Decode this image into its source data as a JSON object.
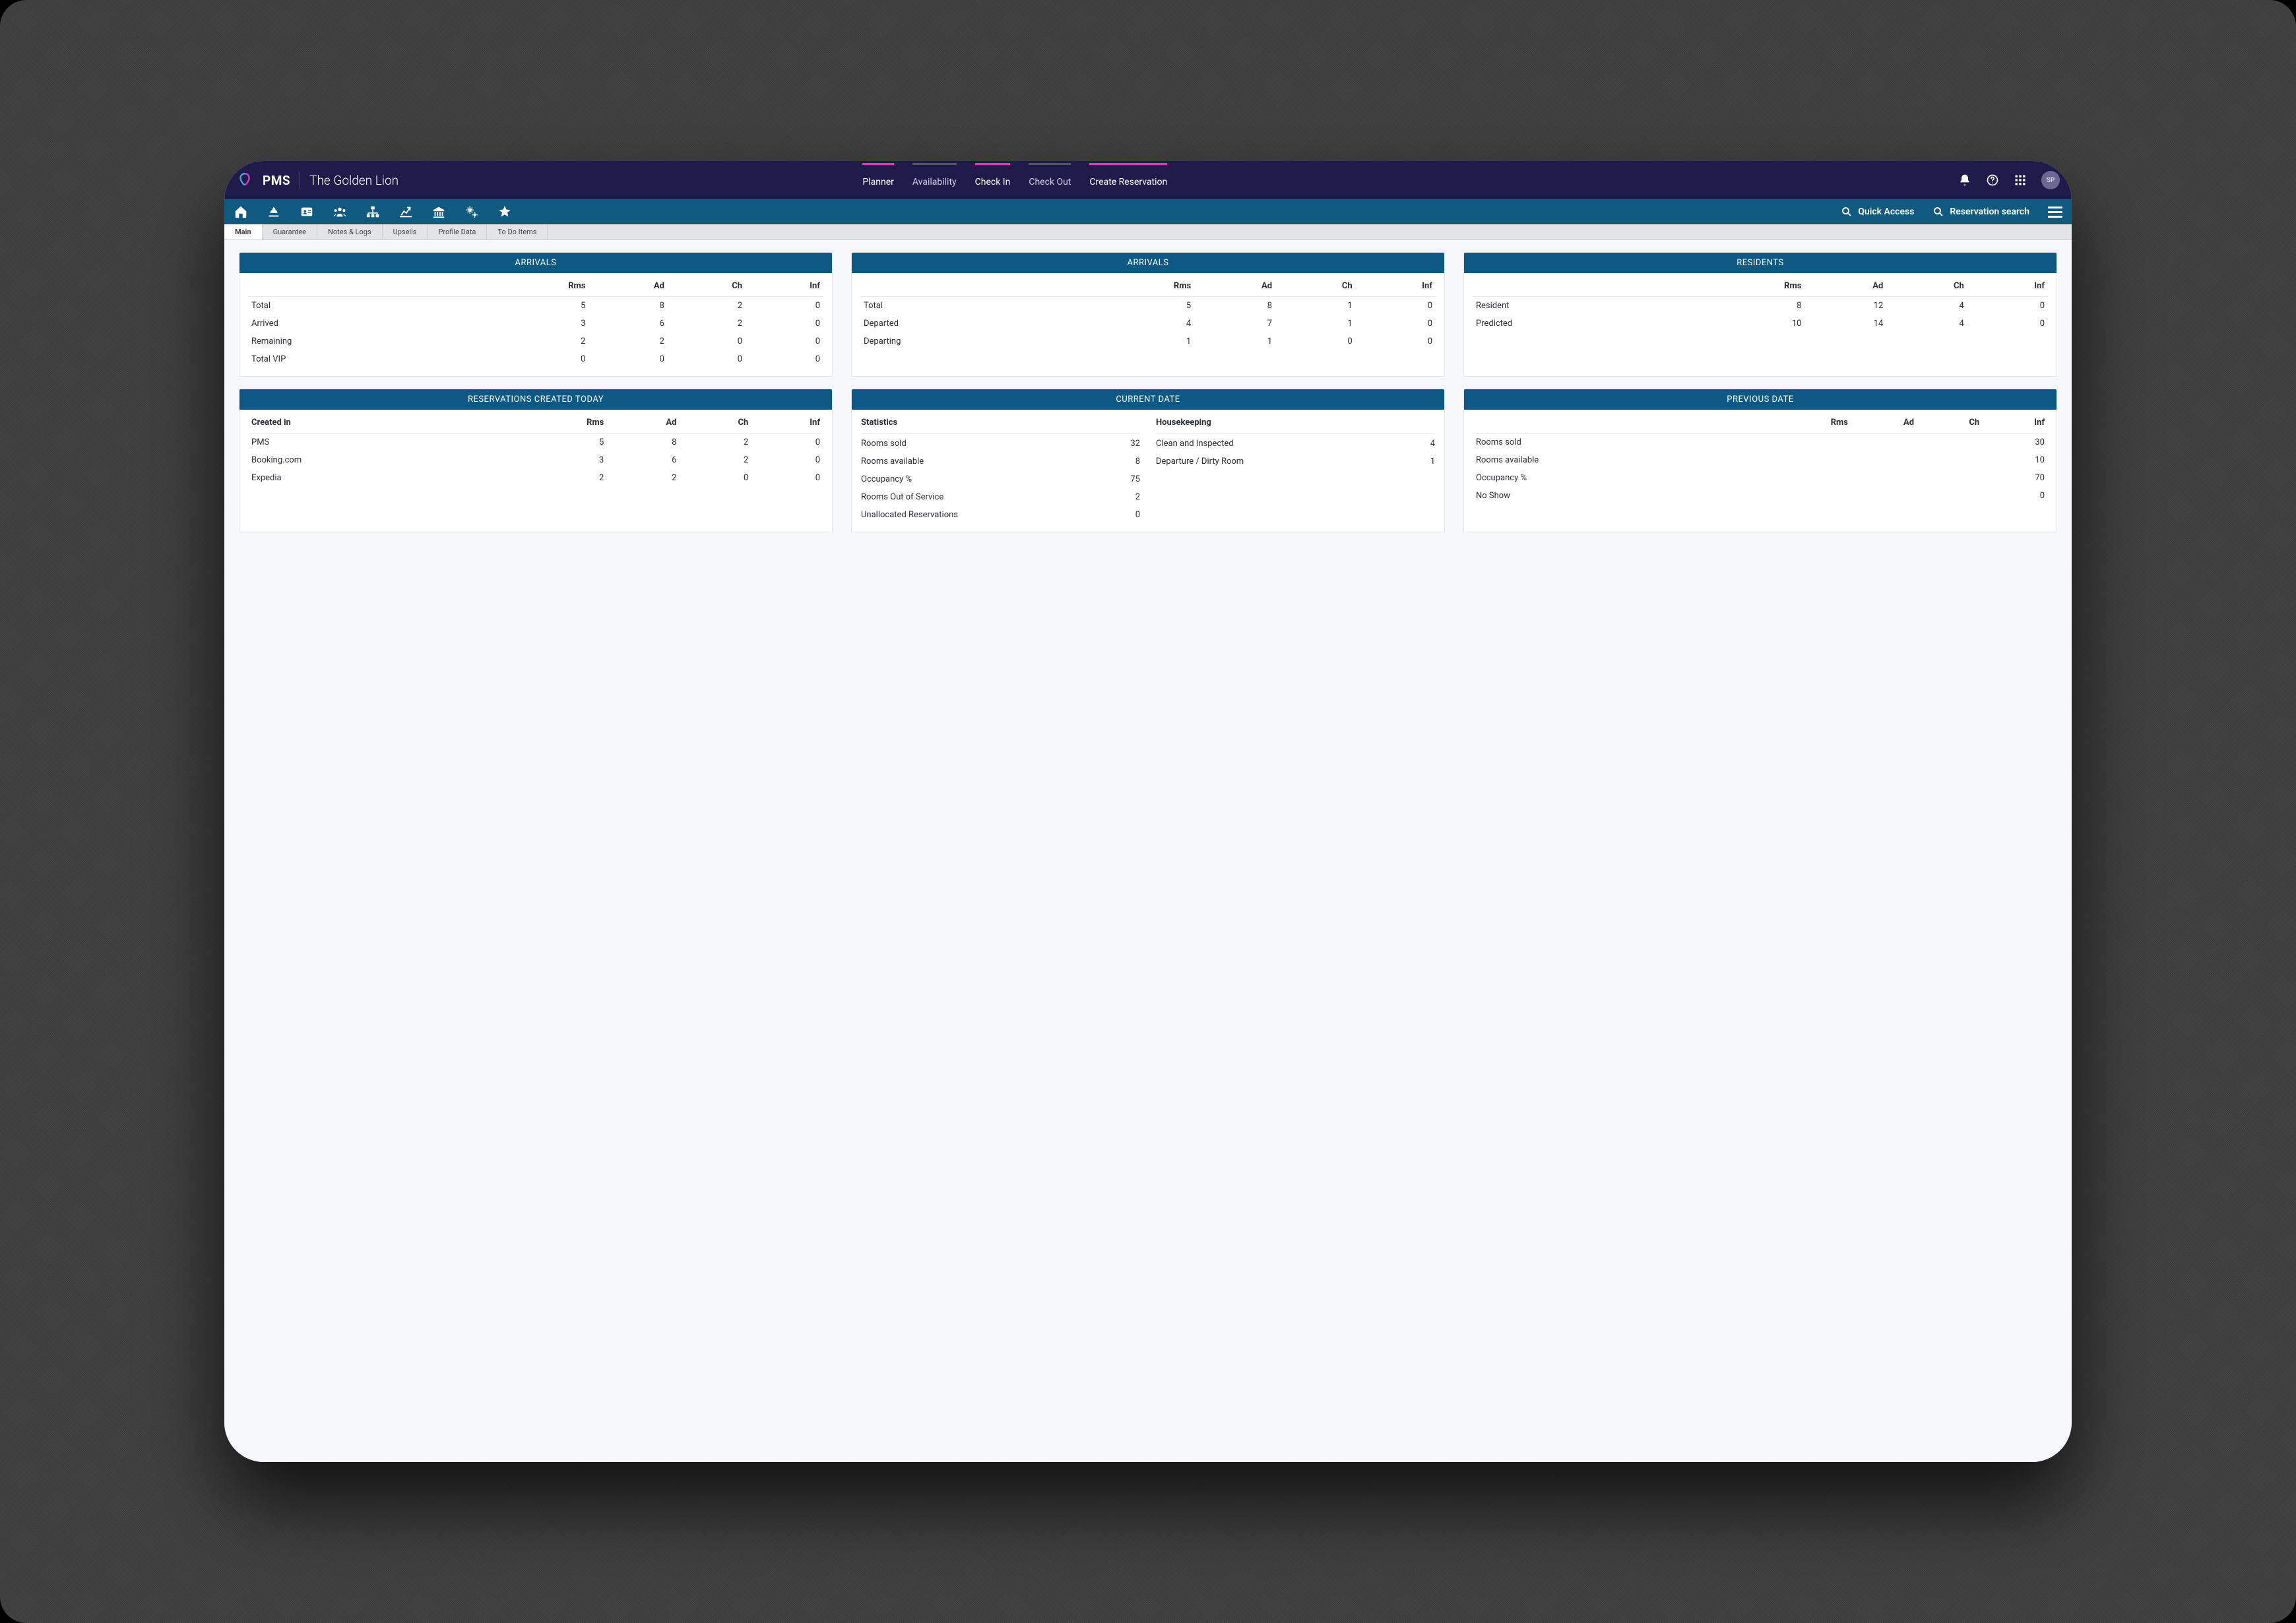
{
  "header": {
    "brand": "PMS",
    "hotel": "The Golden Lion",
    "nav": [
      {
        "label": "Planner",
        "active": true
      },
      {
        "label": "Availability",
        "active": false
      },
      {
        "label": "Check In",
        "active": true
      },
      {
        "label": "Check Out",
        "active": false
      },
      {
        "label": "Create Reservation",
        "active": true
      }
    ],
    "avatar": "SP"
  },
  "iconbar": {
    "search1": "Quick Access",
    "search2": "Reservation search"
  },
  "subtabs": [
    {
      "label": "Main",
      "active": true
    },
    {
      "label": "Guarantee"
    },
    {
      "label": "Notes & Logs"
    },
    {
      "label": "Upsells"
    },
    {
      "label": "Profile Data"
    },
    {
      "label": "To Do Items"
    }
  ],
  "arrivals1": {
    "title": "ARRIVALS",
    "cols": [
      "",
      "Rms",
      "Ad",
      "Ch",
      "Inf"
    ],
    "rows": [
      [
        "Total",
        "5",
        "8",
        "2",
        "0"
      ],
      [
        "Arrived",
        "3",
        "6",
        "2",
        "0"
      ],
      [
        "Remaining",
        "2",
        "2",
        "0",
        "0"
      ],
      [
        "Total VIP",
        "0",
        "0",
        "0",
        "0"
      ]
    ]
  },
  "arrivals2": {
    "title": "ARRIVALS",
    "cols": [
      "",
      "Rms",
      "Ad",
      "Ch",
      "Inf"
    ],
    "rows": [
      [
        "Total",
        "5",
        "8",
        "1",
        "0"
      ],
      [
        "Departed",
        "4",
        "7",
        "1",
        "0"
      ],
      [
        "Departing",
        "1",
        "1",
        "0",
        "0"
      ]
    ]
  },
  "residents": {
    "title": "RESIDENTS",
    "cols": [
      "",
      "Rms",
      "Ad",
      "Ch",
      "Inf"
    ],
    "rows": [
      [
        "Resident",
        "8",
        "12",
        "4",
        "0"
      ],
      [
        "Predicted",
        "10",
        "14",
        "4",
        "0"
      ]
    ]
  },
  "reservations": {
    "title": "RESERVATIONS CREATED TODAY",
    "subhead": "Created in",
    "cols": [
      "",
      "Rms",
      "Ad",
      "Ch",
      "Inf"
    ],
    "rows": [
      [
        "PMS",
        "5",
        "8",
        "2",
        "0"
      ],
      [
        "Booking.com",
        "3",
        "6",
        "2",
        "0"
      ],
      [
        "Expedia",
        "2",
        "2",
        "0",
        "0"
      ]
    ]
  },
  "current": {
    "title": "CURRENT DATE",
    "left": {
      "head": "Statistics",
      "rows": [
        [
          "Rooms sold",
          "32"
        ],
        [
          "Rooms available",
          "8"
        ],
        [
          "Occupancy %",
          "75"
        ],
        [
          "Rooms Out of Service",
          "2"
        ],
        [
          "Unallocated Reservations",
          "0"
        ]
      ]
    },
    "right": {
      "head": "Housekeeping",
      "rows": [
        [
          "Clean and Inspected",
          "4"
        ],
        [
          "Departure / Dirty Room",
          "1"
        ]
      ]
    }
  },
  "previous": {
    "title": "PREVIOUS DATE",
    "cols": [
      "",
      "Rms",
      "Ad",
      "Ch",
      "Inf"
    ],
    "rows": [
      [
        "Rooms sold",
        "",
        "",
        "",
        "30"
      ],
      [
        "Rooms available",
        "",
        "",
        "",
        "10"
      ],
      [
        "Occupancy %",
        "",
        "",
        "",
        "70"
      ],
      [
        "No Show",
        "",
        "",
        "",
        "0"
      ]
    ]
  }
}
